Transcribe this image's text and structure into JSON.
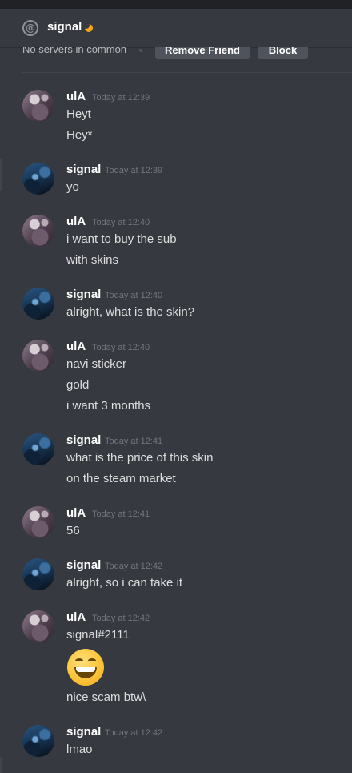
{
  "header": {
    "channel_icon": "at-icon",
    "channel_name": "signal",
    "status_icon": "moon-icon",
    "status_color": "#faa61a"
  },
  "profile": {
    "mutual_servers": "No servers in common",
    "remove_friend_label": "Remove Friend",
    "block_label": "Block"
  },
  "colors": {
    "background": "#36393f",
    "username": "#ffffff",
    "timestamp": "#72767d",
    "message_text": "#dcddde"
  },
  "messages": [
    {
      "author": "ulA",
      "timestamp": "Today at 12:39",
      "lines": [
        "Heyt",
        "Hey*"
      ]
    },
    {
      "author": "signal",
      "timestamp": "Today at 12:39",
      "lines": [
        "yo"
      ]
    },
    {
      "author": "ulA",
      "timestamp": "Today at 12:40",
      "lines": [
        "i want to buy the sub",
        "with skins"
      ]
    },
    {
      "author": "signal",
      "timestamp": "Today at 12:40",
      "lines": [
        "alright, what is the skin?"
      ]
    },
    {
      "author": "ulA",
      "timestamp": "Today at 12:40",
      "lines": [
        "navi sticker",
        "gold",
        "i want 3 months"
      ]
    },
    {
      "author": "signal",
      "timestamp": "Today at 12:41",
      "lines": [
        "what is the price of this skin",
        "on the steam market"
      ]
    },
    {
      "author": "ulA",
      "timestamp": "Today at 12:41",
      "lines": [
        "56"
      ]
    },
    {
      "author": "signal",
      "timestamp": "Today at 12:42",
      "lines": [
        "alright, so i can take it"
      ]
    },
    {
      "author": "ulA",
      "timestamp": "Today at 12:42",
      "lines": [
        "signal#2111",
        "nice scam btw\\"
      ],
      "emoji": "grinning-face-emoji"
    },
    {
      "author": "signal",
      "timestamp": "Today at 12:42",
      "lines": [
        "lmao"
      ]
    }
  ]
}
